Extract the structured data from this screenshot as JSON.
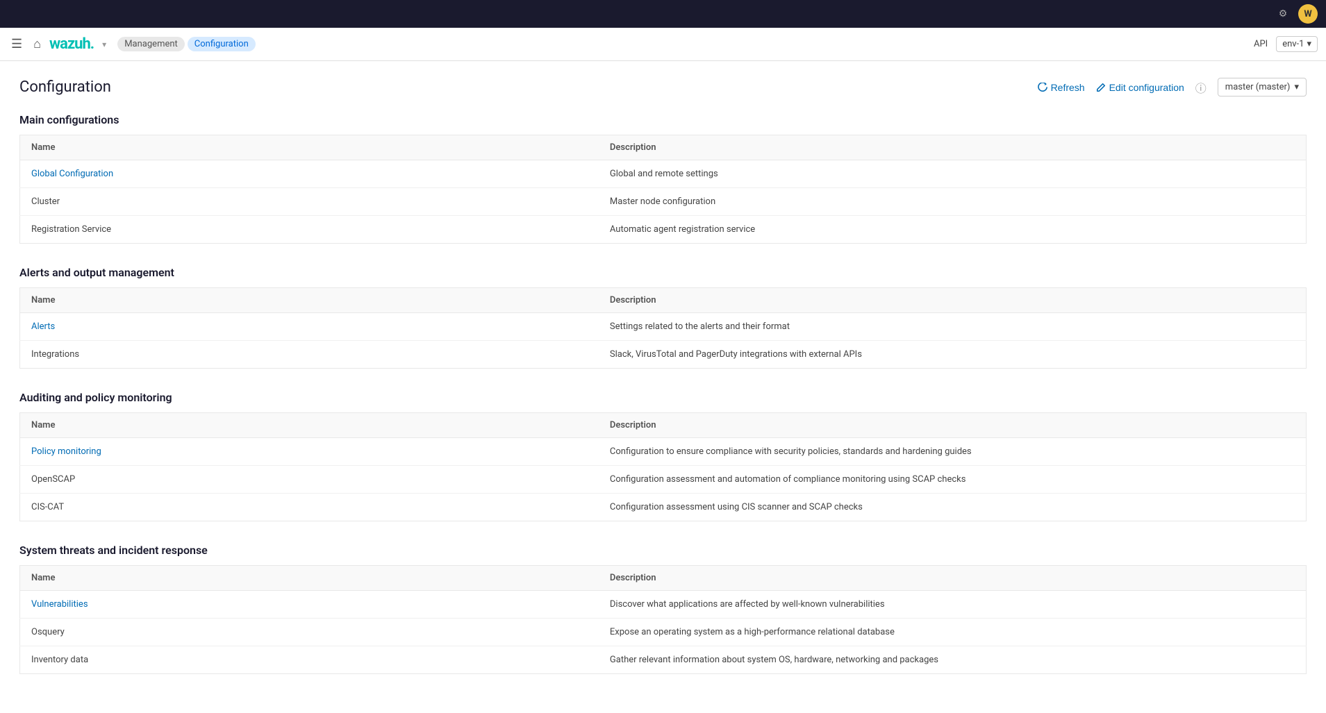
{
  "topbar": {
    "settings_icon": "⚙",
    "avatar_label": "W"
  },
  "navbar": {
    "logo": "wazuh.",
    "breadcrumbs": [
      {
        "label": "Management",
        "active": false
      },
      {
        "label": "Configuration",
        "active": true
      }
    ],
    "api_label": "API",
    "env_label": "env-1"
  },
  "page": {
    "title": "Configuration",
    "refresh_label": "Refresh",
    "edit_config_label": "Edit configuration",
    "node_label": "master (master)"
  },
  "sections": [
    {
      "id": "main-configurations",
      "title": "Main configurations",
      "columns": [
        "Name",
        "Description"
      ],
      "rows": [
        {
          "name": "Global Configuration",
          "description": "Global and remote settings",
          "link": true
        },
        {
          "name": "Cluster",
          "description": "Master node configuration",
          "link": false
        },
        {
          "name": "Registration Service",
          "description": "Automatic agent registration service",
          "link": false
        }
      ]
    },
    {
      "id": "alerts-output",
      "title": "Alerts and output management",
      "columns": [
        "Name",
        "Description"
      ],
      "rows": [
        {
          "name": "Alerts",
          "description": "Settings related to the alerts and their format",
          "link": true
        },
        {
          "name": "Integrations",
          "description": "Slack, VirusTotal and PagerDuty integrations with external APIs",
          "link": false
        }
      ]
    },
    {
      "id": "auditing-policy",
      "title": "Auditing and policy monitoring",
      "columns": [
        "Name",
        "Description"
      ],
      "rows": [
        {
          "name": "Policy monitoring",
          "description": "Configuration to ensure compliance with security policies, standards and hardening guides",
          "link": true
        },
        {
          "name": "OpenSCAP",
          "description": "Configuration assessment and automation of compliance monitoring using SCAP checks",
          "link": false
        },
        {
          "name": "CIS-CAT",
          "description": "Configuration assessment using CIS scanner and SCAP checks",
          "link": false
        }
      ]
    },
    {
      "id": "system-threats",
      "title": "System threats and incident response",
      "columns": [
        "Name",
        "Description"
      ],
      "rows": [
        {
          "name": "Vulnerabilities",
          "description": "Discover what applications are affected by well-known vulnerabilities",
          "link": true
        },
        {
          "name": "Osquery",
          "description": "Expose an operating system as a high-performance relational database",
          "link": false
        },
        {
          "name": "Inventory data",
          "description": "Gather relevant information about system OS, hardware, networking and packages",
          "link": false
        }
      ]
    }
  ]
}
